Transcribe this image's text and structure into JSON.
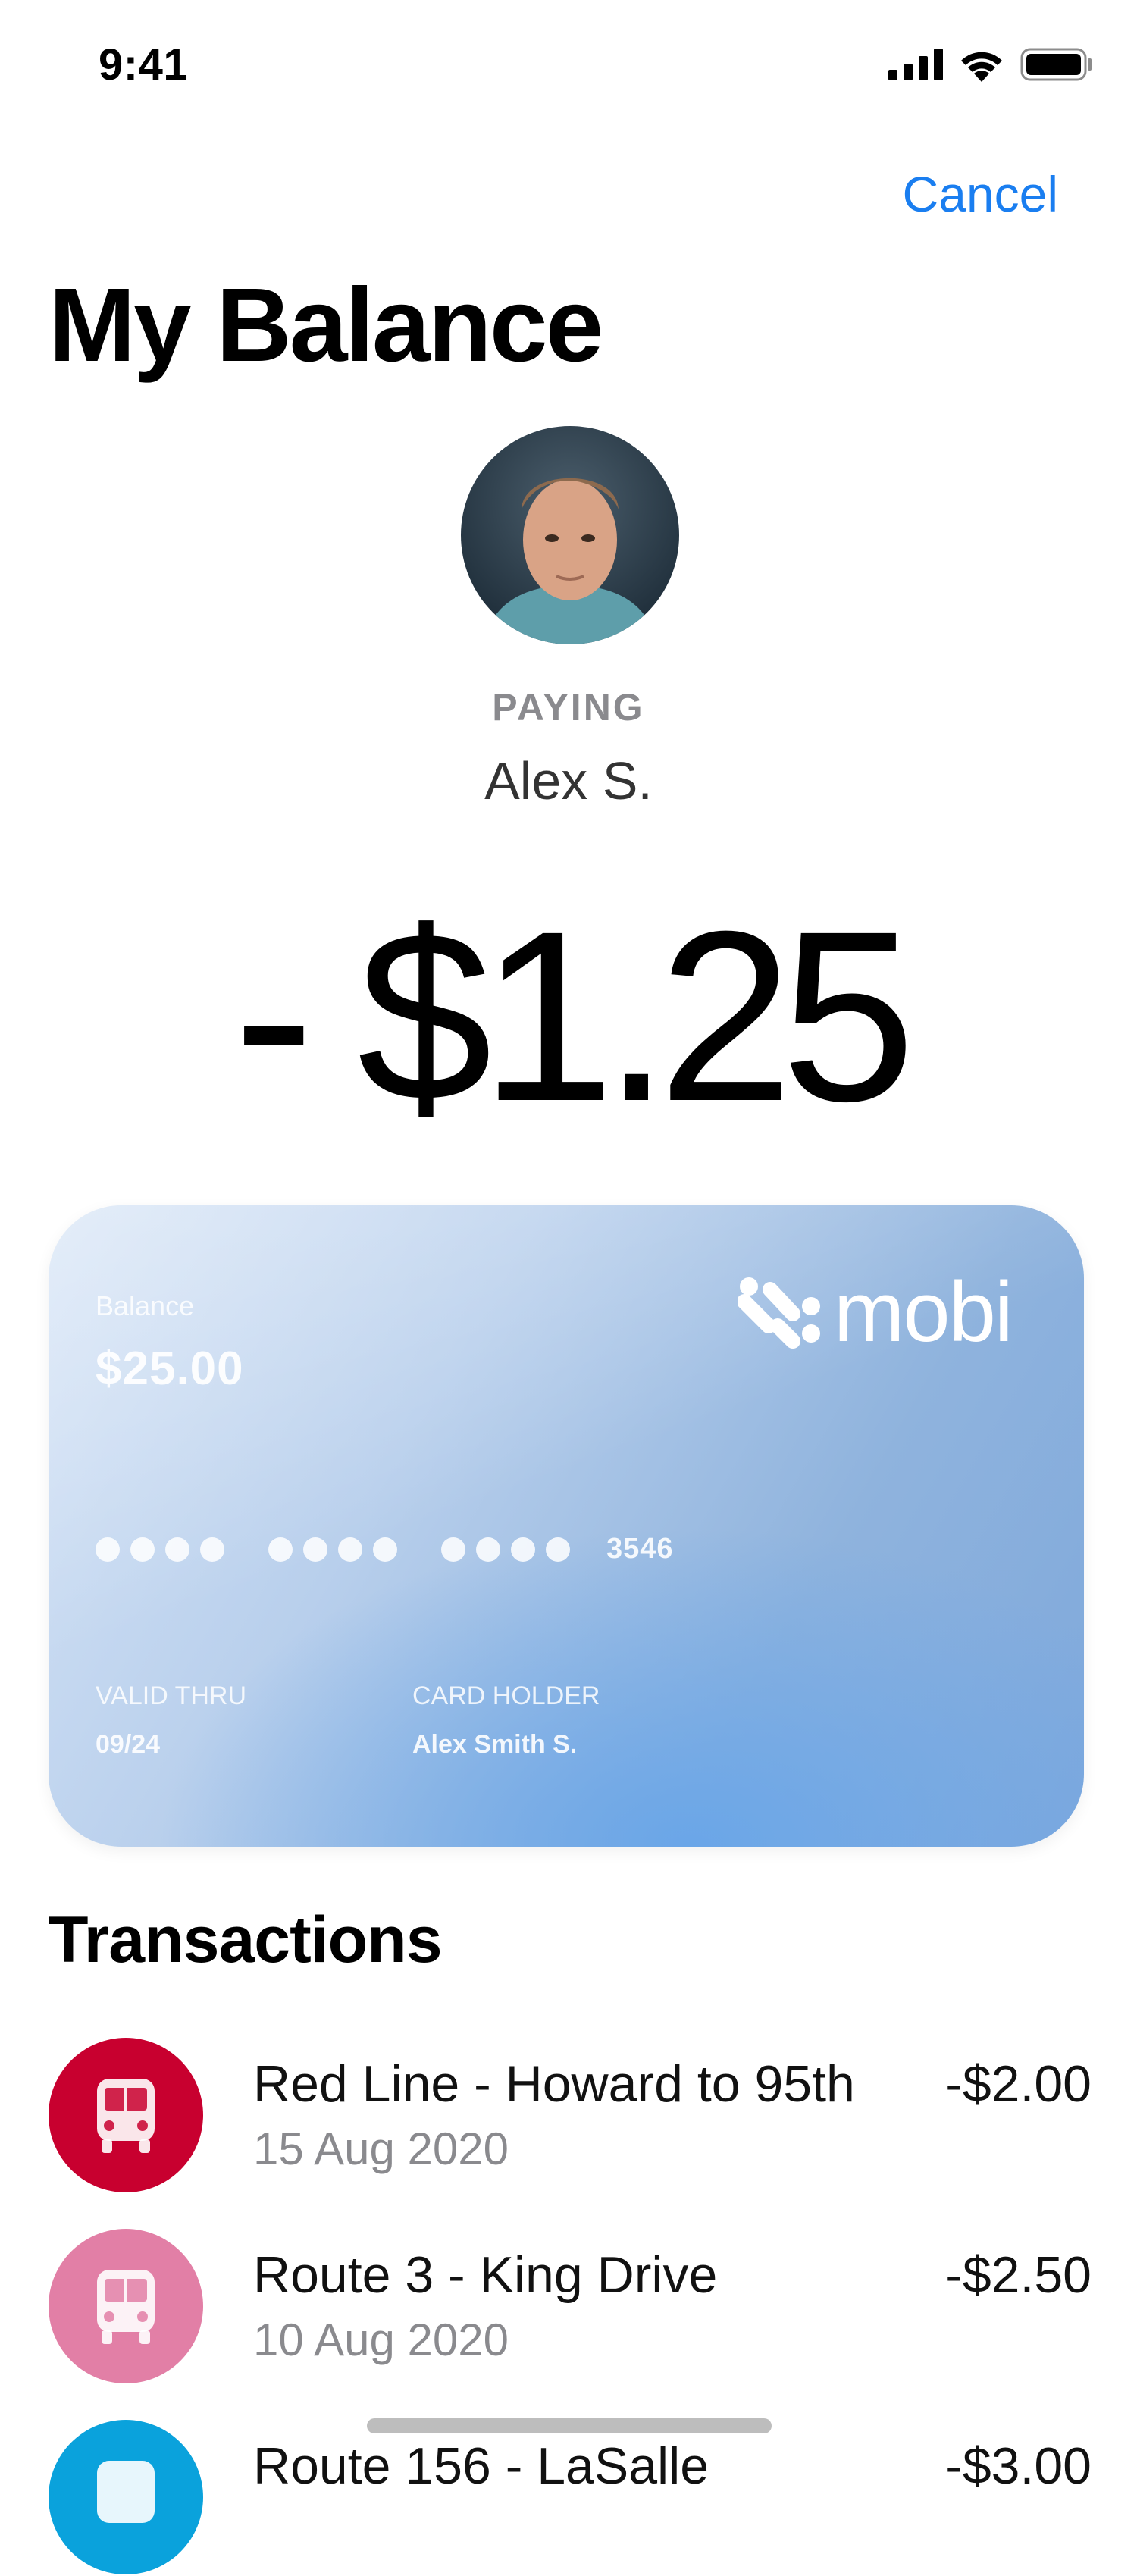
{
  "status_bar": {
    "time": "9:41"
  },
  "nav": {
    "cancel_label": "Cancel"
  },
  "page_title": "My Balance",
  "payer": {
    "label": "PAYING",
    "name": "Alex S."
  },
  "amount": "- $1.25",
  "card": {
    "balance_label": "Balance",
    "balance_value": "$25.00",
    "brand": "mobi",
    "last4": "3546",
    "valid_label": "VALID THRU",
    "valid_value": "09/24",
    "holder_label": "CARD HOLDER",
    "holder_value": "Alex Smith S.",
    "colors": {
      "start": "#d6e4f6",
      "end": "#6aa6e8"
    }
  },
  "transactions": {
    "title": "Transactions",
    "items": [
      {
        "title": "Red Line - Howard to 95th",
        "date": "15 Aug 2020",
        "amount": "-$2.00",
        "icon": "bus-icon",
        "color": "#c8002f"
      },
      {
        "title": "Route 3 - King Drive",
        "date": "10 Aug 2020",
        "amount": "-$2.50",
        "icon": "bus-icon",
        "color": "#e27fa6"
      },
      {
        "title": "Route 156 - LaSalle",
        "date": "",
        "amount": "-$3.00",
        "icon": "bus-icon",
        "color": "#0aa2dc"
      }
    ]
  }
}
